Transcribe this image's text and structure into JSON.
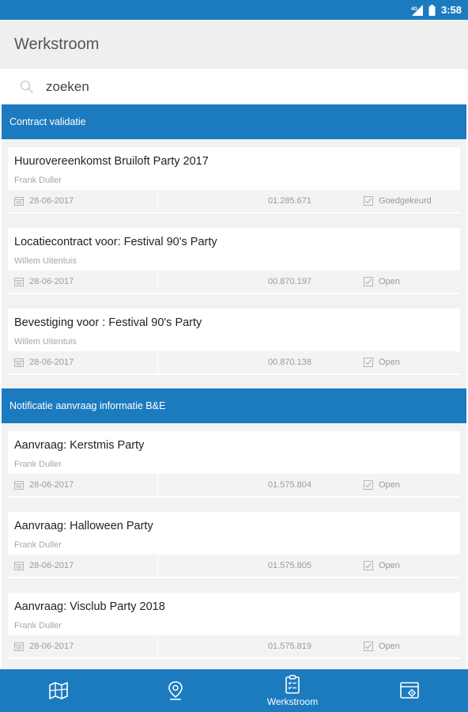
{
  "status_bar": {
    "network": "4G",
    "time": "3:58"
  },
  "app_bar": {
    "title": "Werkstroom"
  },
  "search": {
    "placeholder": "zoeken"
  },
  "sections": [
    {
      "title": "Contract validatie",
      "items": [
        {
          "title": "Huurovereenkomst Bruiloft Party 2017",
          "author": "Frank Duller",
          "date": "28-06-2017",
          "number": "01.285.671",
          "status": "Goedgekeurd"
        },
        {
          "title": "Locatiecontract voor: Festival 90's Party",
          "author": "Willem Uitentuis",
          "date": "28-06-2017",
          "number": "00.870.197",
          "status": "Open"
        },
        {
          "title": "Bevestiging voor : Festival 90's Party",
          "author": "Willem Uitentuis",
          "date": "28-06-2017",
          "number": "00.870.138",
          "status": "Open"
        }
      ]
    },
    {
      "title": "Notificatie aanvraag informatie B&E",
      "items": [
        {
          "title": "Aanvraag: Kerstmis Party",
          "author": "Frank Duller",
          "date": "28-06-2017",
          "number": "01.575.804",
          "status": "Open"
        },
        {
          "title": "Aanvraag: Halloween Party",
          "author": "Frank Duller",
          "date": "28-06-2017",
          "number": "01.575.805",
          "status": "Open"
        },
        {
          "title": "Aanvraag: Visclub Party 2018",
          "author": "Frank Duller",
          "date": "28-06-2017",
          "number": "01.575.819",
          "status": "Open"
        }
      ]
    }
  ],
  "bottom_nav": [
    {
      "icon": "map-icon",
      "label": ""
    },
    {
      "icon": "location-pin-icon",
      "label": ""
    },
    {
      "icon": "clipboard-icon",
      "label": "Werkstroom"
    },
    {
      "icon": "browser-settings-icon",
      "label": ""
    }
  ],
  "colors": {
    "primary": "#1c7bbf",
    "appbar": "#efefef"
  }
}
